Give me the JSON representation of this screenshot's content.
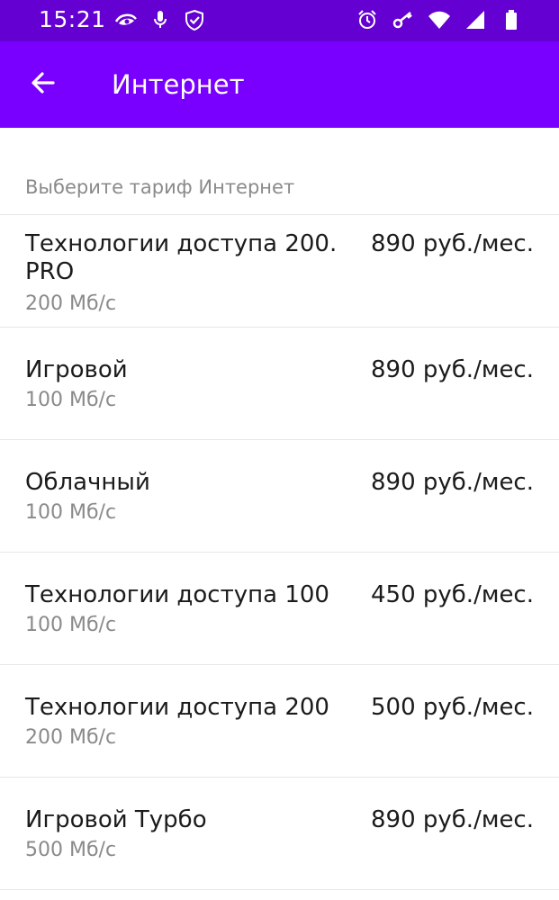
{
  "status_bar": {
    "time": "15:21",
    "left_icons": [
      "eye-icon",
      "mic-icon",
      "shield-check-icon"
    ],
    "right_icons": [
      "alarm-icon",
      "key-icon",
      "wifi-icon",
      "signal-icon",
      "battery-icon"
    ]
  },
  "app_bar": {
    "back_icon": "arrow-left-icon",
    "title": "Интернет",
    "background": "#7900ff"
  },
  "section": {
    "header": "Выберите тариф Интернет"
  },
  "tariffs": [
    {
      "name": "Технологии доступа 200. PRO",
      "price": "890 руб./мес.",
      "speed": "200 Мб/с"
    },
    {
      "name": "Игровой",
      "price": "890 руб./мес.",
      "speed": "100 Мб/с"
    },
    {
      "name": "Облачный",
      "price": "890 руб./мес.",
      "speed": "100 Мб/с"
    },
    {
      "name": "Технологии доступа 100",
      "price": "450 руб./мес.",
      "speed": "100 Мб/с"
    },
    {
      "name": "Технологии доступа 200",
      "price": "500 руб./мес.",
      "speed": "200 Мб/с"
    },
    {
      "name": "Игровой Турбо",
      "price": "890 руб./мес.",
      "speed": "500 Мб/с"
    }
  ]
}
